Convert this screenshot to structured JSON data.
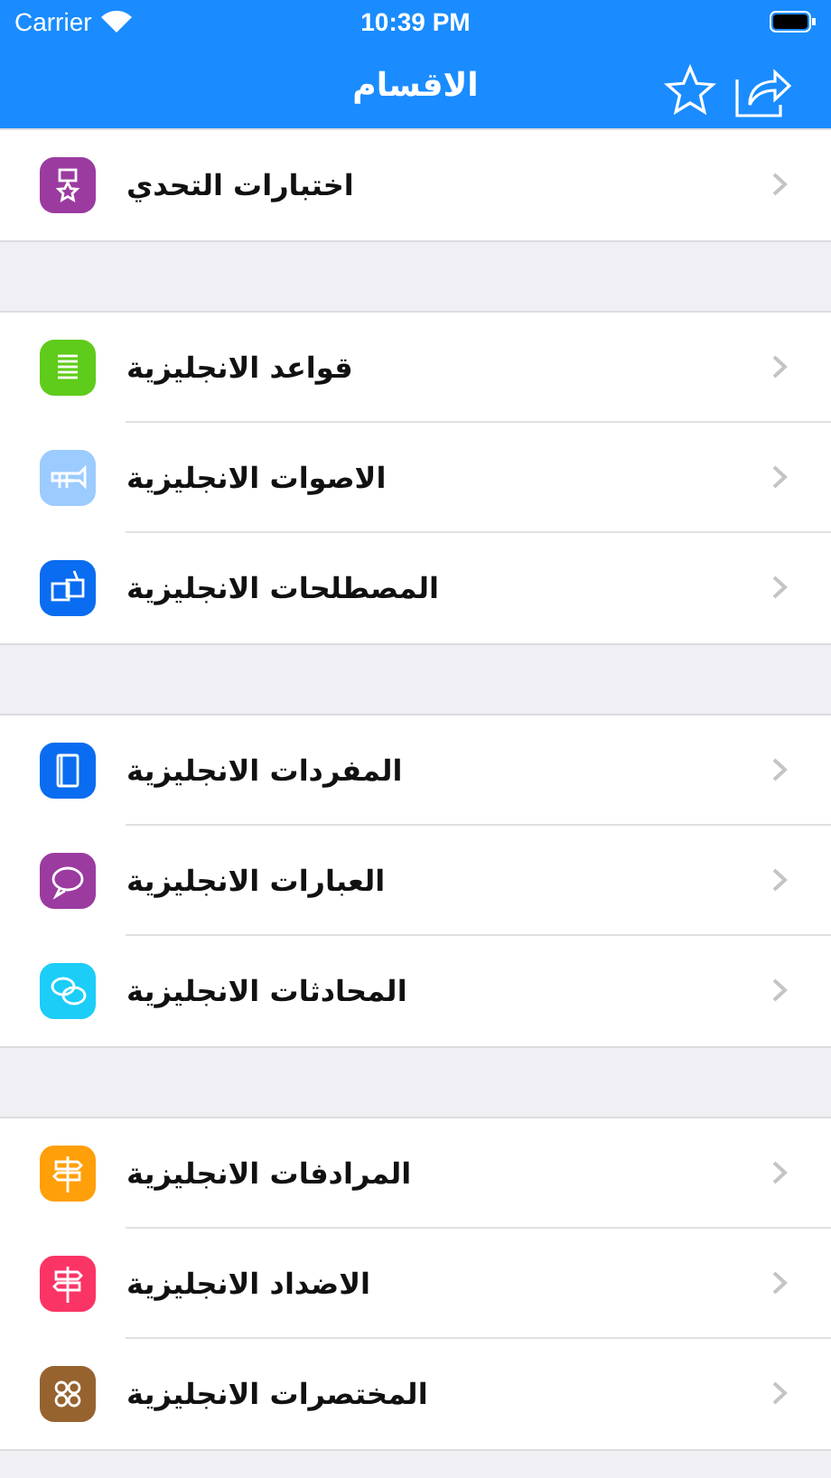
{
  "status_bar": {
    "carrier": "Carrier",
    "time": "10:39 PM"
  },
  "nav_bar": {
    "title": "الاقسام"
  },
  "groups": [
    {
      "items": [
        {
          "label": "اختبارات التحدي",
          "color": "#9b3ba0"
        }
      ]
    },
    {
      "items": [
        {
          "label": "قواعد الانجليزية",
          "color": "#5fcb1a"
        },
        {
          "label": "الاصوات الانجليزية",
          "color": "#9ccbff"
        },
        {
          "label": "المصطلحات الانجليزية",
          "color": "#0a6cf0"
        }
      ]
    },
    {
      "items": [
        {
          "label": "المفردات الانجليزية",
          "color": "#0a6cf0"
        },
        {
          "label": "العبارات الانجليزية",
          "color": "#9b3ba0"
        },
        {
          "label": "المحادثات الانجليزية",
          "color": "#1ccdf8"
        }
      ]
    },
    {
      "items": [
        {
          "label": "المرادفات الانجليزية",
          "color": "#ff9f0a"
        },
        {
          "label": "الاضداد الانجليزية",
          "color": "#fb3466"
        },
        {
          "label": "المختصرات الانجليزية",
          "color": "#96632f"
        }
      ]
    }
  ]
}
